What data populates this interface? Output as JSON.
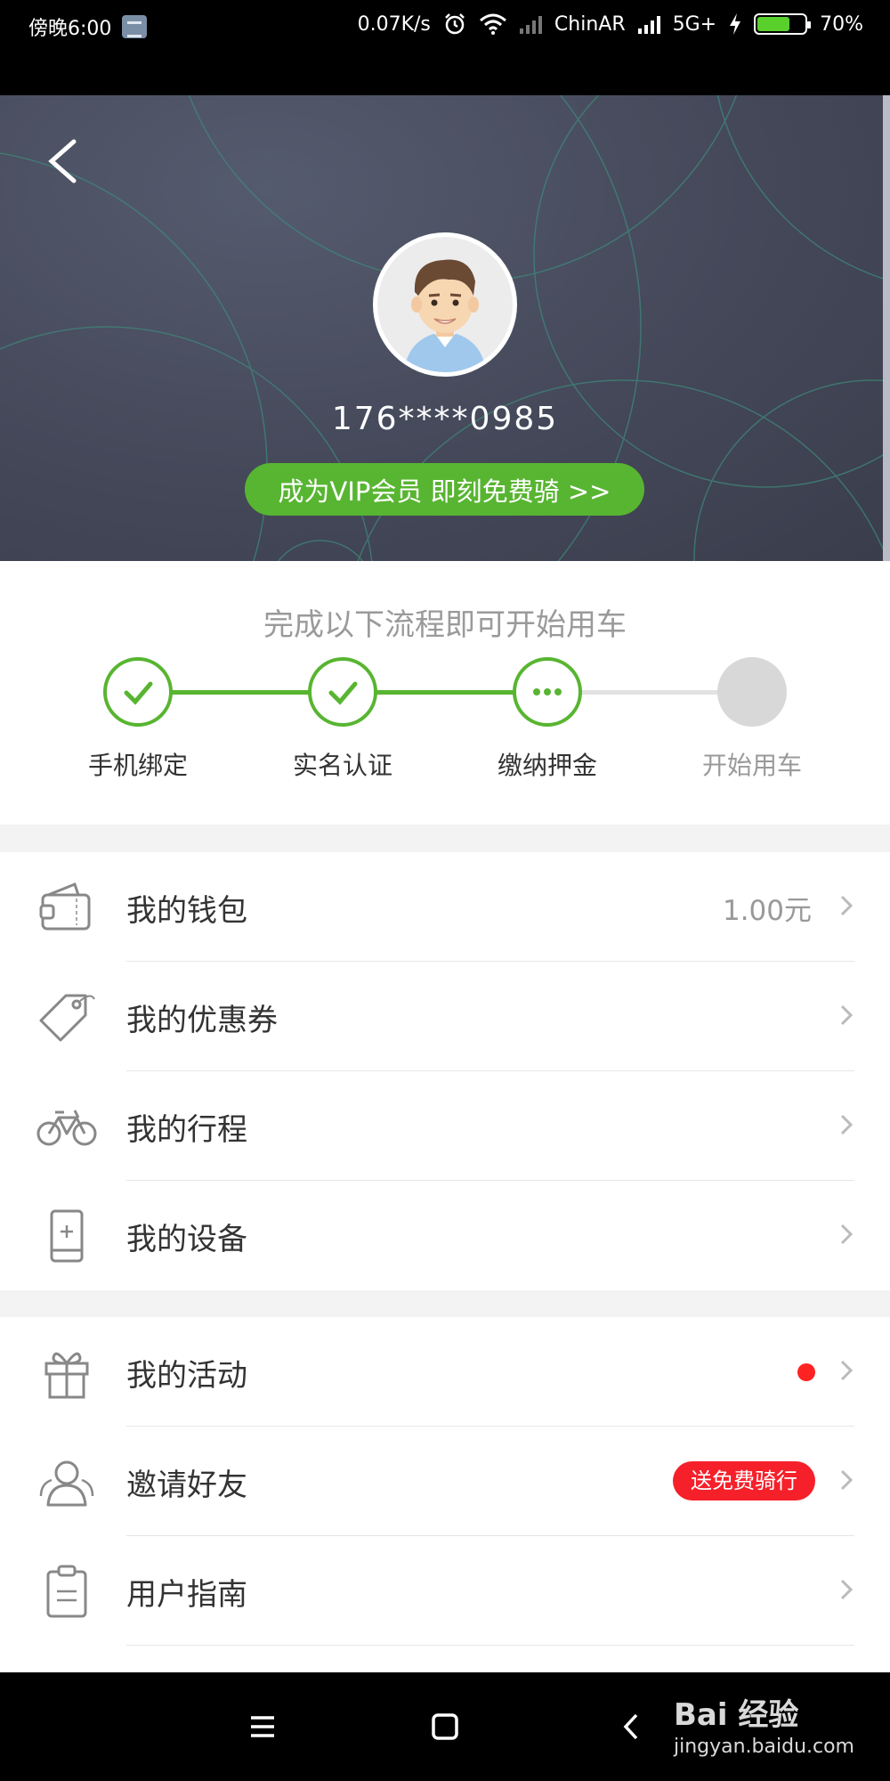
{
  "status_bar": {
    "time": "傍晚6:00",
    "speed": "0.07K/s",
    "carrier": "ChinAR",
    "network": "5G+",
    "battery": "70%"
  },
  "profile": {
    "phone": "176****0985",
    "vip_button": "成为VIP会员 即刻免费骑 >>"
  },
  "progress": {
    "title": "完成以下流程即可开始用车",
    "steps": [
      {
        "label": "手机绑定",
        "state": "done"
      },
      {
        "label": "实名认证",
        "state": "done"
      },
      {
        "label": "缴纳押金",
        "state": "active"
      },
      {
        "label": "开始用车",
        "state": "pending"
      }
    ]
  },
  "menu": {
    "group1": [
      {
        "label": "我的钱包",
        "value": "1.00元",
        "icon": "wallet-icon"
      },
      {
        "label": "我的优惠券",
        "icon": "coupon-icon"
      },
      {
        "label": "我的行程",
        "icon": "bike-icon"
      },
      {
        "label": "我的设备",
        "icon": "device-icon"
      }
    ],
    "group2": [
      {
        "label": "我的活动",
        "icon": "gift-icon",
        "dot": true
      },
      {
        "label": "邀请好友",
        "icon": "friends-icon",
        "badge": "送免费骑行"
      },
      {
        "label": "用户指南",
        "icon": "clipboard-icon"
      }
    ]
  },
  "watermark": {
    "main": "Bai 经验",
    "sub": "jingyan.baidu.com"
  },
  "colors": {
    "accent": "#58b531",
    "header_bg": "#474b5b",
    "badge": "#f5202a"
  }
}
